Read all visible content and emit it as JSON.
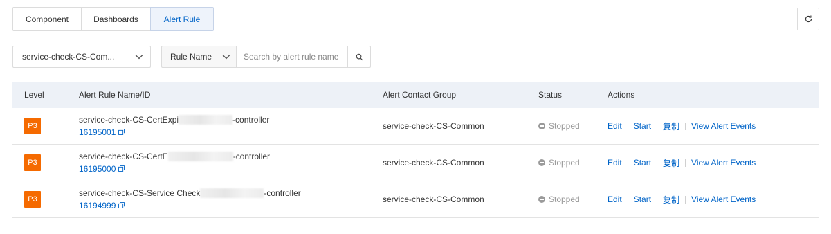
{
  "tabs": [
    {
      "label": "Component"
    },
    {
      "label": "Dashboards"
    },
    {
      "label": "Alert Rule"
    }
  ],
  "filters": {
    "application_value": "service-check-CS-Com...",
    "field_value": "Rule Name",
    "search_placeholder": "Search by alert rule name"
  },
  "table": {
    "headers": {
      "level": "Level",
      "name": "Alert Rule Name/ID",
      "group": "Alert Contact Group",
      "status": "Status",
      "actions": "Actions"
    },
    "rows": [
      {
        "level": "P3",
        "name_prefix": "service-check-CS-CertExpi",
        "name_suffix": "-controller",
        "id": "16195001",
        "group": "service-check-CS-Common",
        "status": "Stopped",
        "actions": [
          "Edit",
          "Start",
          "复制",
          "View Alert Events"
        ]
      },
      {
        "level": "P3",
        "name_prefix": "service-check-CS-CertE",
        "name_suffix": "-controller",
        "id": "16195000",
        "group": "service-check-CS-Common",
        "status": "Stopped",
        "actions": [
          "Edit",
          "Start",
          "复制",
          "View Alert Events"
        ]
      },
      {
        "level": "P3",
        "name_prefix": "service-check-CS-Service Check",
        "name_suffix": "-controller",
        "id": "16194999",
        "group": "service-check-CS-Common",
        "status": "Stopped",
        "actions": [
          "Edit",
          "Start",
          "复制",
          "View Alert Events"
        ]
      }
    ]
  },
  "colors": {
    "accent": "#0064c8",
    "badge": "#f56a00",
    "header_bg": "#edf1f7"
  },
  "icons": {
    "dropdown": "chevron-down-icon",
    "search": "search-icon",
    "refresh": "refresh-icon",
    "external": "external-link-icon",
    "status": "stopped-icon"
  }
}
